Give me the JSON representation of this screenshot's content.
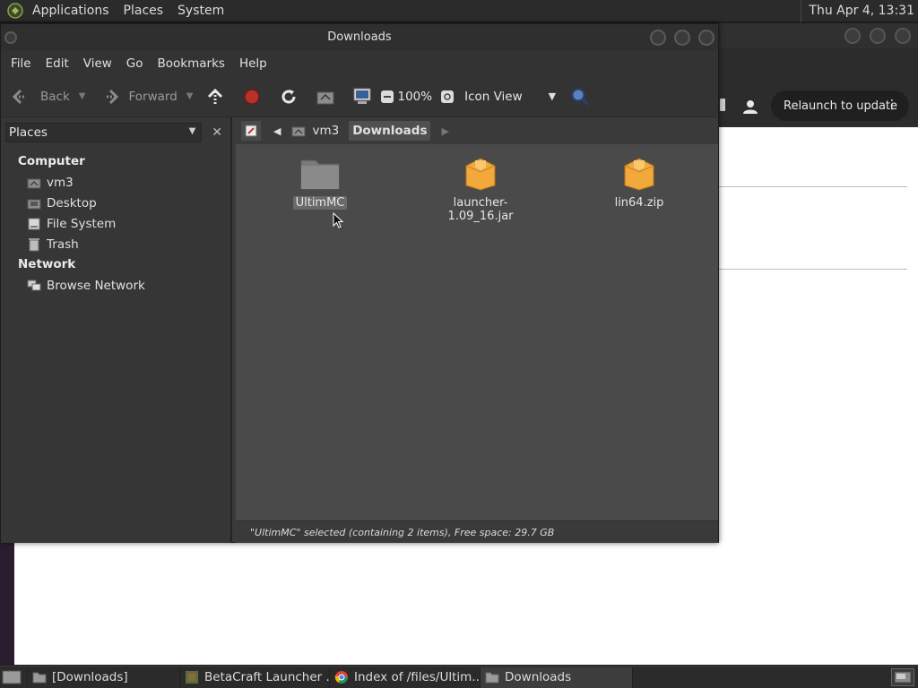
{
  "top_panel": {
    "menus": [
      "Applications",
      "Places",
      "System"
    ],
    "clock": "Thu Apr  4, 13:31"
  },
  "background_browser": {
    "relaunch_label": "Relaunch to update"
  },
  "file_manager": {
    "title": "Downloads",
    "menubar": [
      "File",
      "Edit",
      "View",
      "Go",
      "Bookmarks",
      "Help"
    ],
    "toolbar": {
      "back_label": "Back",
      "forward_label": "Forward",
      "zoom_level": "100%",
      "view_mode": "Icon View"
    },
    "sidebar": {
      "selector_label": "Places",
      "sections": [
        {
          "title": "Computer",
          "items": [
            "vm3",
            "Desktop",
            "File System",
            "Trash"
          ]
        },
        {
          "title": "Network",
          "items": [
            "Browse Network"
          ]
        }
      ]
    },
    "pathbar": {
      "crumbs": [
        "vm3",
        "Downloads"
      ]
    },
    "files": [
      {
        "name": "UltimMC",
        "type": "folder",
        "selected": true
      },
      {
        "name": "launcher-1.09_16.jar",
        "type": "package"
      },
      {
        "name": "lin64.zip",
        "type": "package"
      }
    ],
    "status": "\"UltimMC\" selected (containing 2 items), Free space: 29.7 GB"
  },
  "taskbar": {
    "tasks": [
      {
        "label": "[Downloads]",
        "icon": "folder-icon"
      },
      {
        "label": "BetaCraft Launcher ...",
        "icon": "launcher-icon"
      },
      {
        "label": "Index of /files/Ultim...",
        "icon": "chrome-icon"
      },
      {
        "label": "Downloads",
        "icon": "folder-icon",
        "active": true
      }
    ]
  },
  "colors": {
    "folder": "#7a7a7a",
    "package": "#f2a93b",
    "stop": "#c0392b"
  }
}
